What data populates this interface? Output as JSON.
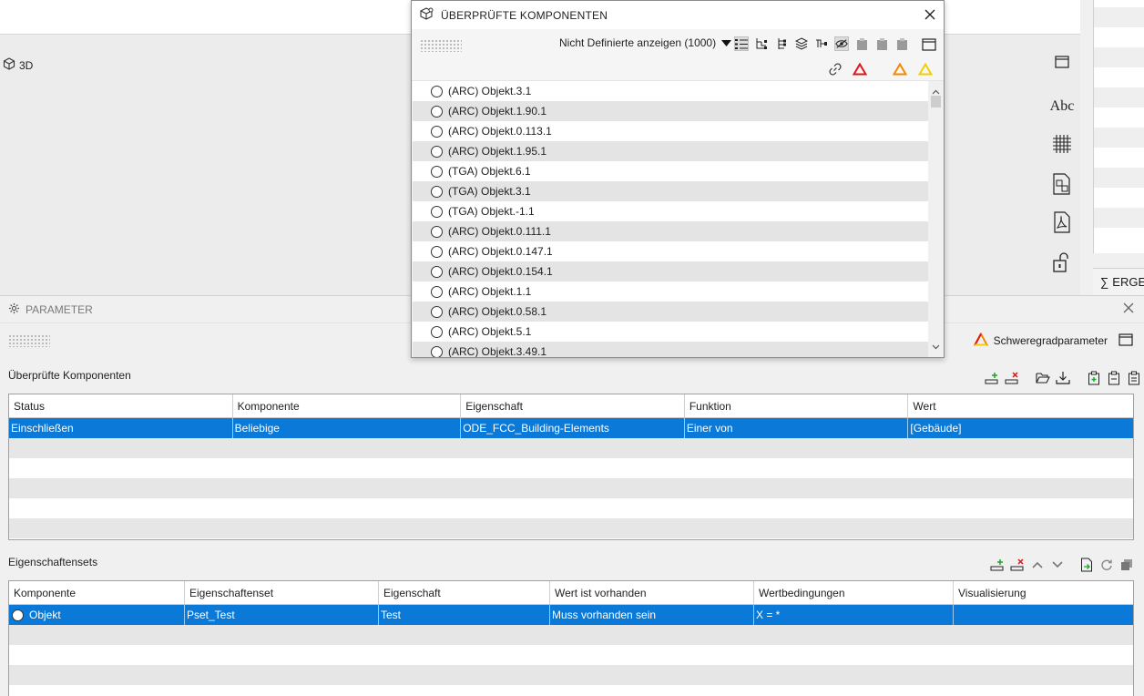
{
  "view": {
    "label": "3D"
  },
  "right_strip": {
    "ergeb_label": "ERGE"
  },
  "right_toolbar": {
    "text_tool_label": "Abc",
    "icons": [
      "layout-icon",
      "text-icon",
      "grid-icon",
      "component-icon",
      "pdf-icon",
      "lock-icon"
    ]
  },
  "parameter_panel": {
    "title": "PARAMETER",
    "severity_button_label": "Schweregradparameter",
    "checked_components_label": "Überprüfte Komponenten",
    "components_table": {
      "columns": [
        "Status",
        "Komponente",
        "Eigenschaft",
        "Funktion",
        "Wert"
      ],
      "rows": [
        [
          "Einschließen",
          "Beliebige",
          "ODE_FCC_Building-Elements",
          "Einer von",
          "[Gebäude]"
        ]
      ]
    },
    "property_sets_label": "Eigenschaftensets",
    "property_sets_table": {
      "columns": [
        "Komponente",
        "Eigenschaftenset",
        "Eigenschaft",
        "Wert ist vorhanden",
        "Wertbedingungen",
        "Visualisierung"
      ],
      "rows": [
        [
          "Objekt",
          "Pset_Test",
          "Test",
          "Muss vorhanden sein",
          "X = *",
          ""
        ]
      ]
    }
  },
  "dialog": {
    "title": "ÜBERPRÜFTE KOMPONENTEN",
    "filter_label": "Nicht Definierte anzeigen (1000)",
    "items": [
      "(ARC) Objekt.3.1",
      "(ARC) Objekt.1.90.1",
      "(ARC) Objekt.0.113.1",
      "(ARC) Objekt.1.95.1",
      "(TGA) Objekt.6.1",
      "(TGA) Objekt.3.1",
      "(TGA) Objekt.-1.1",
      "(ARC) Objekt.0.111.1",
      "(ARC) Objekt.0.147.1",
      "(ARC) Objekt.0.154.1",
      "(ARC) Objekt.1.1",
      "(ARC) Objekt.0.58.1",
      "(ARC) Objekt.5.1",
      "(ARC) Objekt.3.49.1"
    ]
  },
  "colors": {
    "selection": "#0a79d8",
    "severity_high": "#e01515",
    "severity_medium": "#f08a00",
    "severity_low": "#f0d000"
  }
}
